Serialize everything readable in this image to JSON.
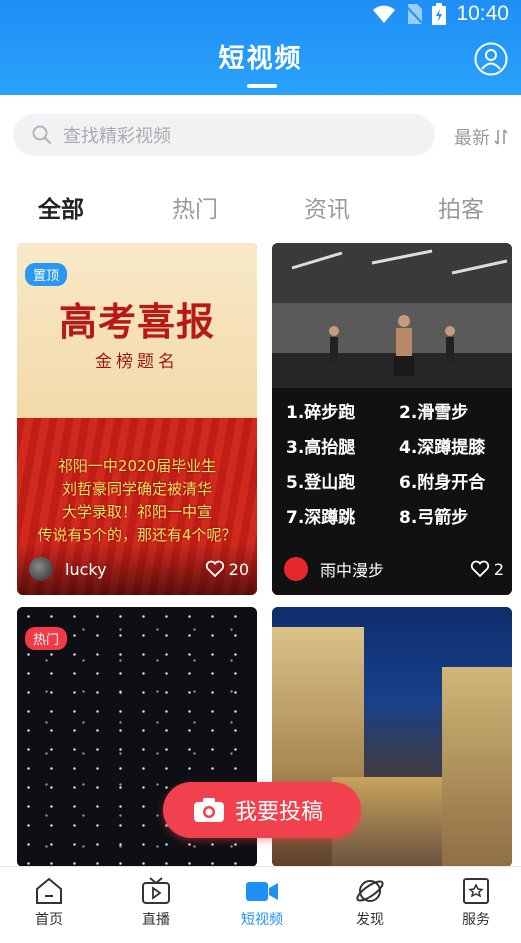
{
  "status_bar": {
    "time": "10:40"
  },
  "header": {
    "title": "短视频"
  },
  "search": {
    "placeholder": "查找精彩视频",
    "sort_label": "最新"
  },
  "tabs": [
    {
      "label": "全部",
      "active": true
    },
    {
      "label": "热门",
      "active": false
    },
    {
      "label": "资讯",
      "active": false
    },
    {
      "label": "拍客",
      "active": false
    }
  ],
  "cards": [
    {
      "badge": "置顶",
      "user": "lucky",
      "likes": "20",
      "poster_title": "高考喜报",
      "poster_subtitle": "金榜题名",
      "poster_lines": [
        "祁阳一中2020届毕业生",
        "刘哲豪同学确定被清华",
        "大学录取！祁阳一中宣",
        "传说有5个的，那还有4个呢？"
      ]
    },
    {
      "user": "雨中漫步",
      "likes": "2",
      "exercises": [
        "1.碎步跑",
        "2.滑雪步",
        "3.高抬腿",
        "4.深蹲提膝",
        "5.登山跑",
        "6.附身开合",
        "7.深蹲跳",
        "8.弓箭步"
      ]
    },
    {
      "badge": "热门"
    },
    {}
  ],
  "fab": {
    "label": "我要投稿"
  },
  "bottom_nav": [
    {
      "label": "首页",
      "icon": "home-icon"
    },
    {
      "label": "直播",
      "icon": "tv-icon"
    },
    {
      "label": "短视频",
      "icon": "video-camera-icon",
      "active": true
    },
    {
      "label": "发现",
      "icon": "planet-icon"
    },
    {
      "label": "服务",
      "icon": "service-icon"
    }
  ],
  "colors": {
    "primary": "#1e92f4",
    "accent": "#f2414e",
    "badge_blue": "#2a97f0",
    "badge_red": "#f03a48"
  }
}
